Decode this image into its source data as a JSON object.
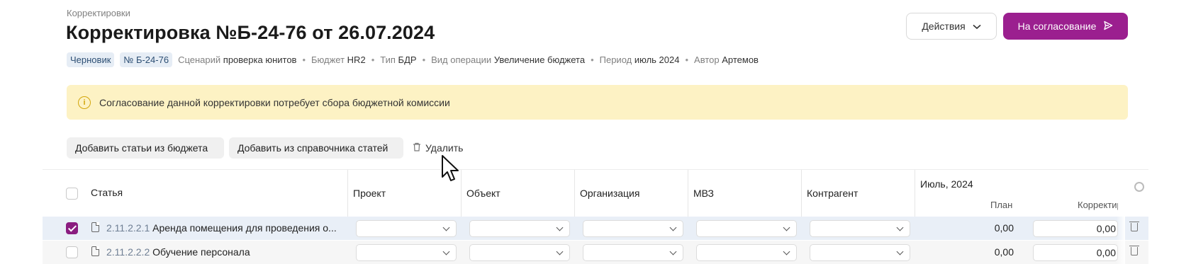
{
  "breadcrumb": "Корректировки",
  "title": "Корректировка №Б-24-76 от 26.07.2024",
  "header": {
    "actions_label": "Действия",
    "approve_label": "На согласование"
  },
  "meta": {
    "status_tag": "Черновик",
    "number_tag": "№ Б-24-76",
    "items": [
      {
        "key": "Сценарий",
        "value": "проверка юнитов"
      },
      {
        "key": "Бюджет",
        "value": "HR2"
      },
      {
        "key": "Тип",
        "value": "БДР"
      },
      {
        "key": "Вид операции",
        "value": "Увеличение бюджета"
      },
      {
        "key": "Период",
        "value": "июль 2024"
      },
      {
        "key": "Автор",
        "value": "Артемов"
      }
    ]
  },
  "alert": {
    "text": "Согласование данной корректировки потребует сбора бюджетной комиссии"
  },
  "toolbar": {
    "add_from_budget": "Добавить статьи из бюджета",
    "add_from_catalog": "Добавить из справочника статей",
    "delete": "Удалить"
  },
  "table": {
    "columns": {
      "item": "Статья",
      "project": "Проект",
      "object": "Объект",
      "organization": "Организация",
      "mvz": "МВЗ",
      "counterparty": "Контрагент",
      "period": "Июль, 2024",
      "plan": "План",
      "correction": "Корректир"
    },
    "rows": [
      {
        "code": "2.11.2.2.1",
        "name": "Аренда помещения для проведения о...",
        "plan": "0,00",
        "correction": "0,00",
        "checked": true
      },
      {
        "code": "2.11.2.2.2",
        "name": "Обучение персонала",
        "plan": "0,00",
        "correction": "0,00",
        "checked": false
      }
    ]
  },
  "colors": {
    "brand": "#9b1f8f",
    "alert_bg": "#fdf2c4",
    "selected_row": "#e9eff7"
  }
}
